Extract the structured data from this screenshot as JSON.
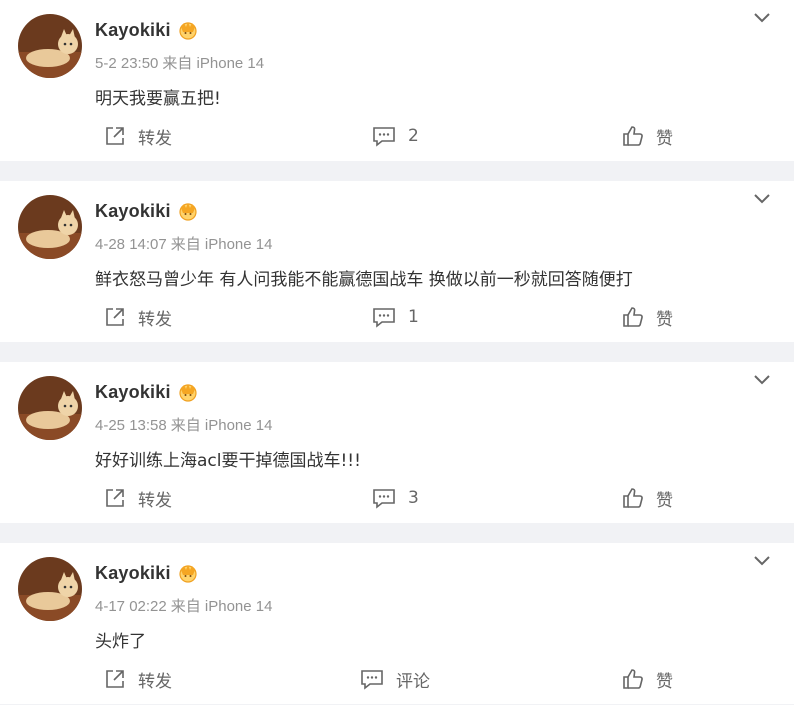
{
  "posts": [
    {
      "author": "Kayokiki",
      "date": "5-2 23:50",
      "source": "来自 iPhone 14",
      "text": "明天我要赢五把!",
      "repost_label": "转发",
      "comment_label": "2",
      "like_label": "赞"
    },
    {
      "author": "Kayokiki",
      "date": "4-28 14:07",
      "source": "来自 iPhone 14",
      "text": "鲜衣怒马曾少年 有人问我能不能赢德国战车 换做以前一秒就回答随便打",
      "repost_label": "转发",
      "comment_label": "1",
      "like_label": "赞"
    },
    {
      "author": "Kayokiki",
      "date": "4-25 13:58",
      "source": "来自 iPhone 14",
      "text": "好好训练上海acl要干掉德国战车!!!",
      "repost_label": "转发",
      "comment_label": "3",
      "like_label": "赞"
    },
    {
      "author": "Kayokiki",
      "date": "4-17 02:22",
      "source": "来自 iPhone 14",
      "text": "头炸了",
      "repost_label": "转发",
      "comment_label": "评论",
      "like_label": "赞"
    }
  ],
  "icons": {
    "more": "chevron-down-icon",
    "repost": "share-icon",
    "comment": "comment-icon",
    "like": "thumbs-up-icon",
    "badge": "vip-crown-icon"
  },
  "colors": {
    "background": "#f1f2f5",
    "card": "#ffffff",
    "text": "#333333",
    "meta": "#939393",
    "action": "#666666",
    "badge": "#f5a623"
  }
}
